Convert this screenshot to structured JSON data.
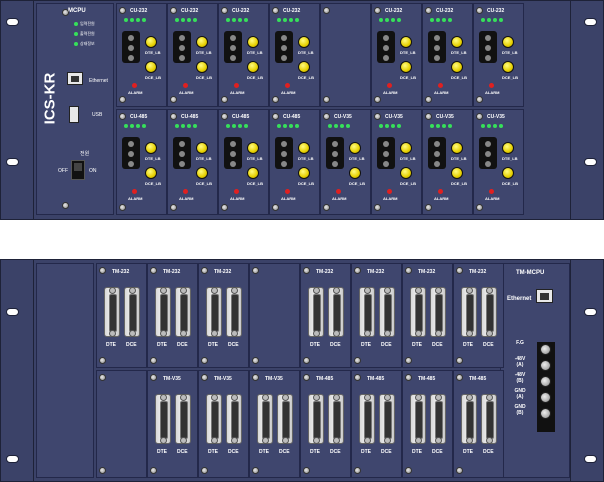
{
  "top_unit": {
    "brand": "ICS-KR",
    "mcpu_label": "MCPU",
    "status_leds": [
      "입력전원",
      "출력전원",
      "상태정보"
    ],
    "ethernet_label": "Ethernet",
    "usb_label": "USB",
    "power_label": "전원",
    "power_off": "OFF",
    "power_on": "ON",
    "row1_cards": [
      "CU-232",
      "CU-232",
      "CU-232",
      "CU-232",
      "",
      "CU-232",
      "CU-232",
      "CU-232"
    ],
    "row2_cards": [
      "CU-485",
      "CU-485",
      "CU-485",
      "CU-485",
      "CU-V35",
      "CU-V35",
      "CU-V35",
      "CU-V35"
    ],
    "dte_lb": "DTE_LB",
    "dce_lb": "DCE_LB",
    "alarm": "ALARM"
  },
  "bottom_unit": {
    "row1_cards": [
      "TM-232",
      "TM-232",
      "TM-232",
      "",
      "TM-232",
      "TM-232",
      "TM-232",
      "TM-232"
    ],
    "row2_cards": [
      "",
      "TM-V35",
      "TM-V35",
      "TM-V35",
      "TM-485",
      "TM-485",
      "TM-485",
      "TM-485"
    ],
    "dte": "DTE",
    "dce": "DCE",
    "mcpu_label": "TM-MCPU",
    "ethernet_label": "Ethernet",
    "terminals": [
      "F.G",
      "-48V\n(A)",
      "-48V\n(B)",
      "GND\n(A)",
      "GND\n(B)"
    ]
  },
  "colors": {
    "panel": "#3b4268",
    "accent": "#f0e000",
    "alarm": "#e02020",
    "led": "#36e05a"
  }
}
